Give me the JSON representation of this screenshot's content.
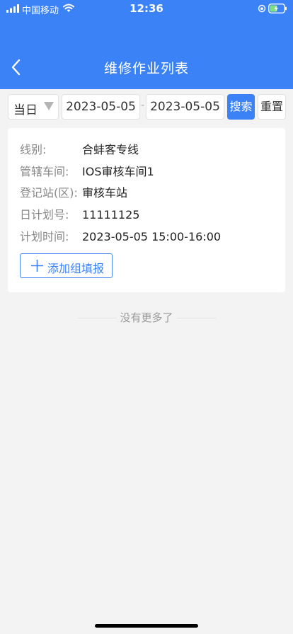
{
  "status_bar": {
    "carrier": "中国移动",
    "time": "12:36",
    "icons": [
      "signal-icon",
      "wifi-icon",
      "orientation-lock-icon",
      "battery-icon"
    ]
  },
  "header": {
    "title": "维修作业列表",
    "back_icon": "back-chevron-icon"
  },
  "filters": {
    "day_select": "当日",
    "start_date": "2023-05-05",
    "separator": "-",
    "end_date": "2023-05-05",
    "search_label": "搜索",
    "reset_label": "重置"
  },
  "card": {
    "fields": [
      {
        "label": "线别:",
        "value": "合蚌客专线"
      },
      {
        "label": "管辖车间:",
        "value": "IOS审核车间1"
      },
      {
        "label": "登记站(区):",
        "value": "审核车站"
      },
      {
        "label": "日计划号:",
        "value": "11111125"
      },
      {
        "label": "计划时间:",
        "value": "2023-05-05 15:00-16:00"
      }
    ],
    "add_button_label": "添加组填报"
  },
  "footer": {
    "no_more_text": "没有更多了"
  },
  "colors": {
    "primary": "#3b82f6",
    "background": "#f3f3f3"
  }
}
